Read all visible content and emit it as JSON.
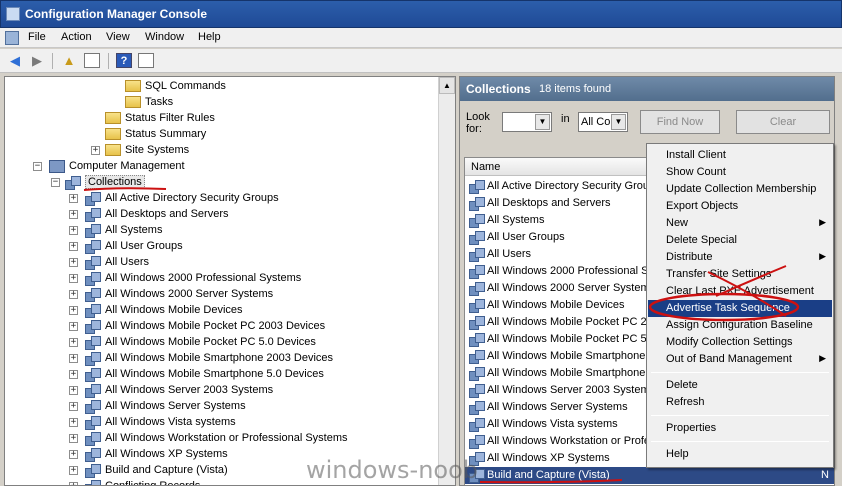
{
  "window": {
    "title": "Configuration Manager Console"
  },
  "menu": {
    "items": [
      "File",
      "Action",
      "View",
      "Window",
      "Help"
    ]
  },
  "toolbar": {
    "icons": [
      "back-arrow-icon",
      "forward-arrow-icon",
      "up-folder-icon",
      "show-hide-tree-icon",
      "help-icon",
      "properties-icon"
    ],
    "help_glyph": "?"
  },
  "tree": {
    "items": [
      {
        "label": "SQL Commands",
        "icon": "folder-icon"
      },
      {
        "label": "Tasks",
        "icon": "folder-icon"
      },
      {
        "label": "Status Filter Rules",
        "icon": "folder-icon"
      },
      {
        "label": "Status Summary",
        "icon": "folder-icon"
      },
      {
        "label": "Site Systems",
        "icon": "folder-icon"
      },
      {
        "label": "Computer Management",
        "icon": "computer-icon"
      },
      {
        "label": "Collections",
        "icon": "collection-icon"
      },
      {
        "label": "All Active Directory Security Groups",
        "icon": "collection-icon"
      },
      {
        "label": "All Desktops and Servers",
        "icon": "collection-icon"
      },
      {
        "label": "All Systems",
        "icon": "collection-icon"
      },
      {
        "label": "All User Groups",
        "icon": "collection-icon"
      },
      {
        "label": "All Users",
        "icon": "collection-icon"
      },
      {
        "label": "All Windows 2000 Professional Systems",
        "icon": "collection-icon"
      },
      {
        "label": "All Windows 2000 Server Systems",
        "icon": "collection-icon"
      },
      {
        "label": "All Windows Mobile Devices",
        "icon": "collection-icon"
      },
      {
        "label": "All Windows Mobile Pocket PC 2003 Devices",
        "icon": "collection-icon"
      },
      {
        "label": "All Windows Mobile Pocket PC 5.0 Devices",
        "icon": "collection-icon"
      },
      {
        "label": "All Windows Mobile Smartphone 2003 Devices",
        "icon": "collection-icon"
      },
      {
        "label": "All Windows Mobile Smartphone 5.0 Devices",
        "icon": "collection-icon"
      },
      {
        "label": "All Windows Server 2003 Systems",
        "icon": "collection-icon"
      },
      {
        "label": "All Windows Server Systems",
        "icon": "collection-icon"
      },
      {
        "label": "All Windows Vista systems",
        "icon": "collection-icon"
      },
      {
        "label": "All Windows Workstation or Professional Systems",
        "icon": "collection-icon"
      },
      {
        "label": "All Windows XP Systems",
        "icon": "collection-icon"
      },
      {
        "label": "Build and Capture (Vista)",
        "icon": "collection-icon"
      },
      {
        "label": "Conflicting Records",
        "icon": "collection-icon"
      }
    ],
    "expander_plus": "+",
    "expander_minus": "−"
  },
  "right_pane": {
    "title": "Collections",
    "count": "18 items found",
    "look_for_label": "Look for:",
    "in_label": "in",
    "look_for_value": "",
    "in_value": "All Col",
    "find_now": "Find Now",
    "clear": "Clear",
    "column_name": "Name",
    "rows": [
      "All Active Directory Security Grou",
      "All Desktops and Servers",
      "All Systems",
      "All User Groups",
      "All Users",
      "All Windows 2000 Professional Sy",
      "All Windows 2000 Server Systems",
      "All Windows Mobile Devices",
      "All Windows Mobile Pocket PC 200",
      "All Windows Mobile Pocket PC 5.0",
      "All Windows Mobile Smartphone 2",
      "All Windows Mobile Smartphone 5",
      "All Windows Server 2003 Systems",
      "All Windows Server Systems",
      "All Windows Vista systems",
      "All Windows Workstation or Profe",
      "All Windows XP Systems",
      "Build and Capture (Vista)"
    ],
    "selected_row_side": "N"
  },
  "context_menu": {
    "items": [
      {
        "label": "Install Client"
      },
      {
        "label": "Show Count"
      },
      {
        "label": "Update Collection Membership"
      },
      {
        "label": "Export Objects"
      },
      {
        "label": "New",
        "submenu": true
      },
      {
        "label": "Delete Special"
      },
      {
        "label": "Distribute",
        "submenu": true
      },
      {
        "label": "Transfer Site Settings"
      },
      {
        "label": "Clear Last PXE Advertisement"
      },
      {
        "label": "Advertise Task Sequence",
        "highlighted": true
      },
      {
        "label": "Assign Configuration Baseline"
      },
      {
        "label": "Modify Collection Settings"
      },
      {
        "label": "Out of Band Management",
        "submenu": true
      },
      {
        "label": "Delete"
      },
      {
        "label": "Refresh"
      },
      {
        "label": "Properties"
      },
      {
        "label": "Help"
      }
    ],
    "submenu_arrow": "▶"
  },
  "watermark": "windows-noob",
  "colors": {
    "title_bar": "#2c5eab",
    "highlight": "#1a3e86",
    "annotation_red": "#cc1111"
  }
}
